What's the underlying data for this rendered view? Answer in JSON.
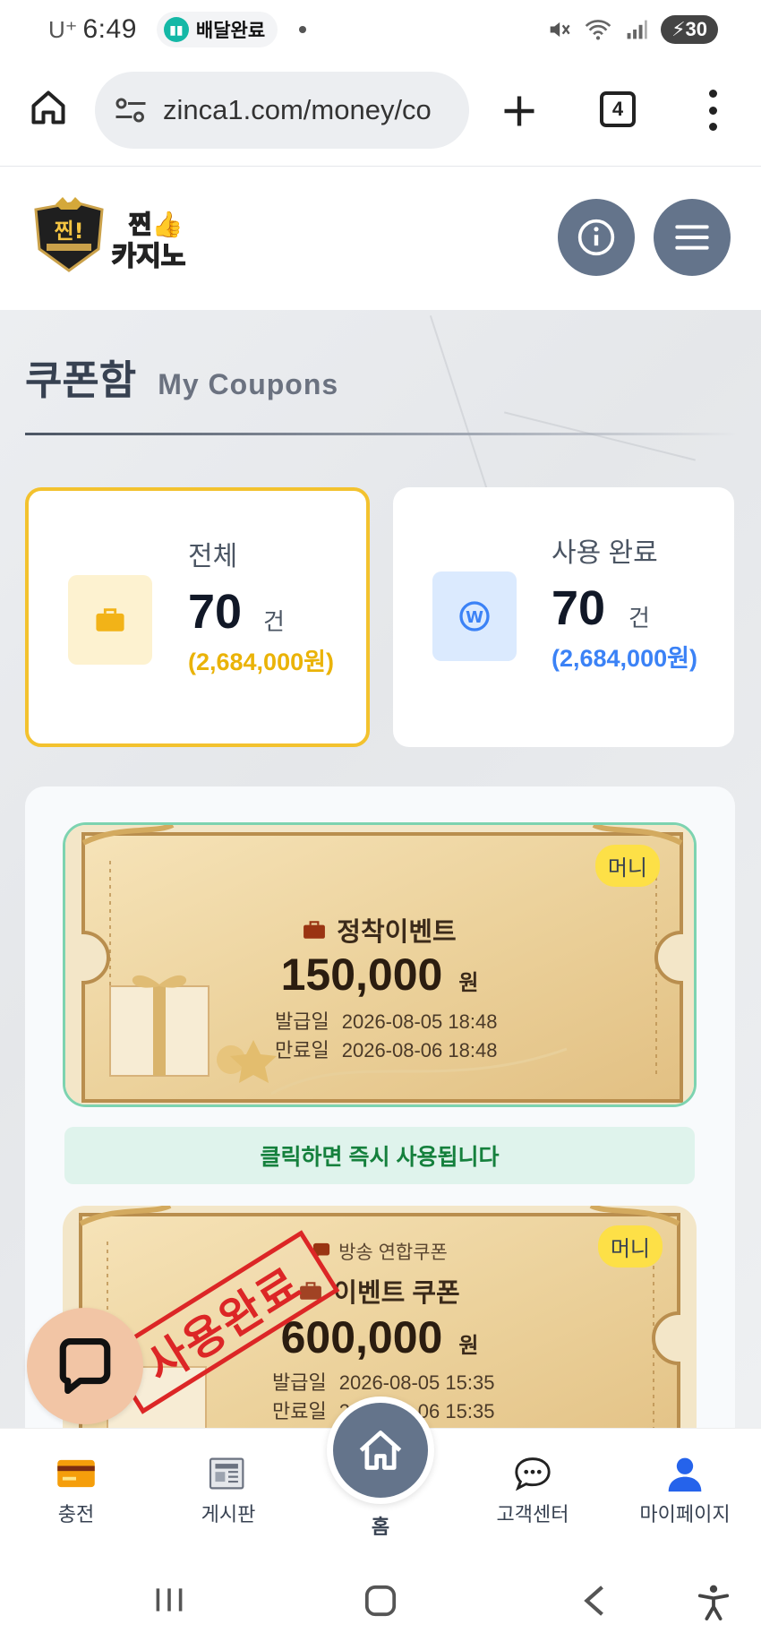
{
  "status_bar": {
    "carrier": "U⁺",
    "time": "6:49",
    "notification": "배달완료",
    "battery": "30"
  },
  "browser": {
    "url": "zinca1.com/money/co",
    "tab_count": "4"
  },
  "site": {
    "logo_text_top": "찐!",
    "logo_text": "찐카지노"
  },
  "page": {
    "title_ko": "쿠폰함",
    "title_en": "My Coupons"
  },
  "stats": {
    "total": {
      "label": "전체",
      "count": "70",
      "unit": "건",
      "amount": "(2,684,000원)",
      "color": "#eab308"
    },
    "used": {
      "label": "사용 완료",
      "count": "70",
      "unit": "건",
      "amount": "(2,684,000원)",
      "color": "#3b82f6"
    }
  },
  "coupons": [
    {
      "badge": "머니",
      "title": "정착이벤트",
      "amount": "150,000",
      "currency": "원",
      "issued_label": "발급일",
      "issued": "2026-08-05 18:48",
      "expiry_label": "만료일",
      "expiry": "2026-08-06 18:48",
      "hint": "클릭하면 즉시 사용됩니다"
    },
    {
      "badge": "머니",
      "subtitle": "방송 연합쿠폰",
      "title": "이벤트 쿠폰",
      "amount": "600,000",
      "currency": "원",
      "issued_label": "발급일",
      "issued": "2026-08-05 15:35",
      "expiry_label": "만료일",
      "expiry": "2026-08-06 15:35",
      "stamp": "사용완료"
    }
  ],
  "bottom_nav": {
    "charge": "충전",
    "board": "게시판",
    "home": "홈",
    "support": "고객센터",
    "mypage": "마이페이지"
  }
}
